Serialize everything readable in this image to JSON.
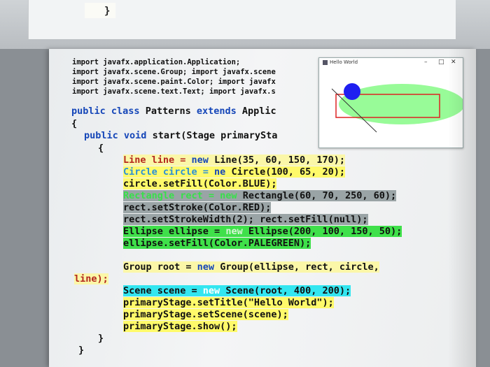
{
  "top_page": {
    "brace": "}"
  },
  "imports": [
    "import javafx.application.Application;",
    "import javafx.scene.Group; import javafx.scene",
    "import javafx.scene.paint.Color; import javafx",
    "import javafx.scene.text.Text; import javafx.s"
  ],
  "class_decl": {
    "kw1": "public",
    "kw2": "class",
    "name": "Patterns",
    "kw3": "extends",
    "rest": "Applic"
  },
  "brace_open": "{",
  "method_decl": {
    "kw1": "public",
    "kw2": "void",
    "rest": "start(Stage primarySta"
  },
  "method_brace": "{",
  "body": {
    "l1_a": "Line line = ",
    "l1_kw": "new",
    "l1_b": " Line(35, 60, 150, 170);",
    "l2_a": "Circle circle = ",
    "l2_kw": "ne",
    "l2_b": " Circle(100, 65, 20);",
    "l3": "circle.setFill(Color.BLUE);",
    "l4_a": "Rectangle rect = ",
    "l4_kw": "new",
    "l4_b": " Rectangle(60, 70, 250, 60);",
    "l5": "rect.setStroke(Color.RED);",
    "l6": "rect.setStrokeWidth(2); rect.setFill(null);",
    "l7_a": "Ellipse ellipse = ",
    "l7_kw": "new",
    "l7_b": " Ellipse(200, 100, 150, 50);",
    "l8": "ellipse.setFill(Color.PALEGREEN);",
    "g_a": "Group root = ",
    "g_kw": "new",
    "g_b": " Group(ellipse, rect, circle,",
    "g_cont": "line);",
    "s_a": "Scene scene = ",
    "s_kw": "new",
    "s_b": " Scene(root, 400, 200);",
    "s2": "primaryStage.setTitle(\"Hello World\");",
    "s3": "primaryStage.setScene(scene);",
    "s4": "primaryStage.show();"
  },
  "method_close": "}",
  "class_close": "}",
  "window": {
    "title": "Hello World",
    "minimize": "–",
    "maximize": "□",
    "close": "✕"
  },
  "colors": {
    "palegreen": "#98FB98",
    "blue": "#0000FF",
    "red": "#FF0000",
    "keyword": "#1546b8"
  }
}
